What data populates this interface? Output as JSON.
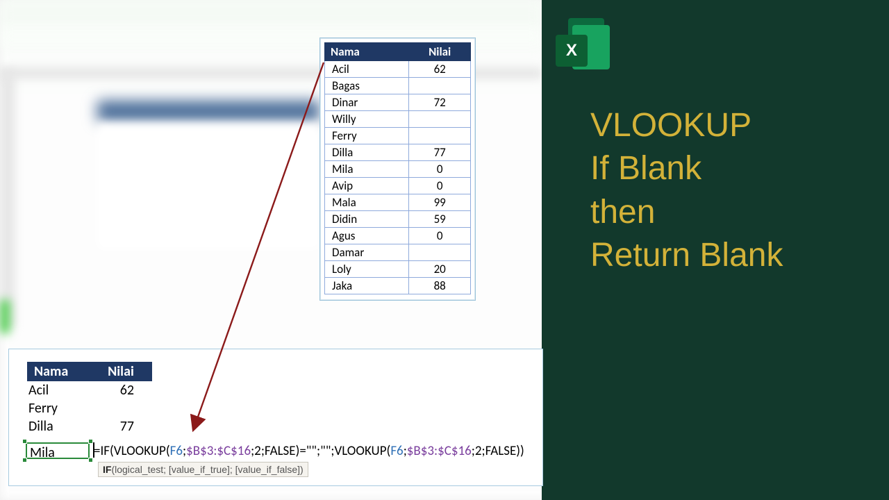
{
  "excel_badge": "X",
  "title_lines": [
    "VLOOKUP",
    "If Blank",
    "then",
    "Return Blank"
  ],
  "table1": {
    "headers": [
      "Nama",
      "Nilai"
    ],
    "rows": [
      [
        "Acil",
        "62"
      ],
      [
        "Bagas",
        ""
      ],
      [
        "Dinar",
        "72"
      ],
      [
        "Willy",
        ""
      ],
      [
        "Ferry",
        ""
      ],
      [
        "Dilla",
        "77"
      ],
      [
        "Mila",
        "0"
      ],
      [
        "Avip",
        "0"
      ],
      [
        "Mala",
        "99"
      ],
      [
        "Didin",
        "59"
      ],
      [
        "Agus",
        "0"
      ],
      [
        "Damar",
        ""
      ],
      [
        "Loly",
        "20"
      ],
      [
        "Jaka",
        "88"
      ]
    ]
  },
  "table2": {
    "headers": [
      "Nama",
      "Nilai"
    ],
    "rows": [
      [
        "Acil",
        "62"
      ],
      [
        "Ferry",
        ""
      ],
      [
        "Dilla",
        "77"
      ]
    ],
    "selected_name": "Mila"
  },
  "formula": {
    "p1": "=IF(",
    "p2": "VLOOKUP(",
    "ref1": "F6",
    "sep": ";",
    "abs": "$B$3:$C$16",
    "col": "2",
    "false": "FALSE",
    "close": ")",
    "eq": "=\"\";\"\";",
    "final_close": "))"
  },
  "tooltip": {
    "fn": "IF",
    "sig": "(logical_test; [value_if_true]; [value_if_false])"
  }
}
